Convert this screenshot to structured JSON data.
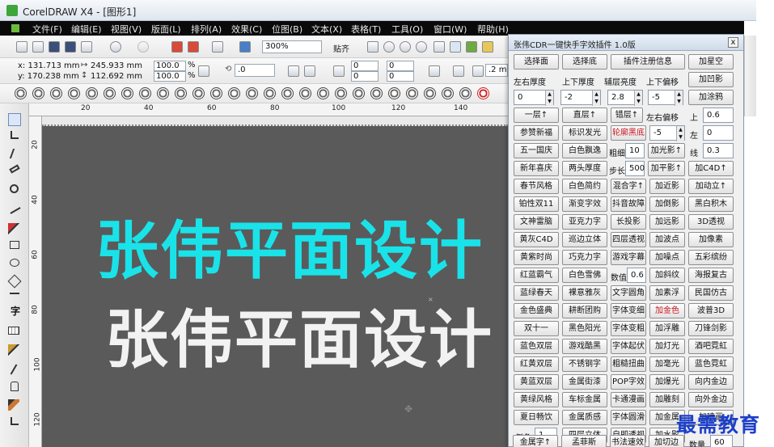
{
  "window": {
    "title": "CorelDRAW X4 - [图形1]"
  },
  "menu": [
    "文件(F)",
    "编辑(E)",
    "视图(V)",
    "版面(L)",
    "排列(A)",
    "效果(C)",
    "位图(B)",
    "文本(X)",
    "表格(T)",
    "工具(O)",
    "窗口(W)",
    "帮助(H)"
  ],
  "toolbar": {
    "zoom": "300%",
    "snap_label": "贴齐"
  },
  "property_bar": {
    "x": "x: 131.713 mm",
    "y": "y: 170.238 mm",
    "width": "245.933 mm",
    "height": "112.692 mm",
    "scale_x": "100.0",
    "scale_y": "100.0",
    "percent": "%",
    "angle": ".0",
    "nudge": ".2 mm",
    "offsets": [
      "0",
      "0",
      "0",
      "0"
    ]
  },
  "ruler": {
    "h_ticks": [
      "20",
      "40",
      "60",
      "80",
      "100",
      "120",
      "140"
    ],
    "v_ticks": [
      "20",
      "40",
      "60",
      "80",
      "100",
      "120"
    ]
  },
  "canvas": {
    "text_cyan": "张伟平面设计",
    "text_white": "张伟平面设计",
    "colors": {
      "cyan": "#19e3e9",
      "white": "#f2f2f2",
      "background": "#5a5a5a"
    }
  },
  "plugin": {
    "title": "张伟CDR一键快手字效插件  1.0版",
    "close": "x",
    "row1": [
      "选择面",
      "选择底",
      "插件注册信息",
      "加星空"
    ],
    "labels_row2": [
      "左右厚度",
      "上下厚度",
      "辅层亮度",
      "上下偏移"
    ],
    "add_shadow": "加凹影",
    "fields_row3": [
      "0",
      "-2",
      "2.8",
      "-5"
    ],
    "add_rust": "加涂鸦",
    "row4": [
      "一层↑",
      "直层↑",
      "错层↑"
    ],
    "lr_offset": "左右偏移",
    "up_label": "上",
    "up_value": "0.6",
    "row5": [
      "参赞新福",
      "标识发光",
      "轮廓黑底"
    ],
    "row5_field": "-5",
    "left_label": "左",
    "left_value": "0",
    "row6": [
      "五一国庆",
      "白色飘逸"
    ],
    "thick_label": "粗细",
    "thick_value": "10",
    "row6_btn": "加光影↑",
    "line_label": "线",
    "line_value": "0.3",
    "row7": [
      "新年喜庆",
      "两头厚度"
    ],
    "step_label": "步长",
    "step_value": "500",
    "row7_btns": [
      "加平影↑",
      "加C4D↑"
    ],
    "grid": [
      [
        "春节风格",
        "白色简约",
        "混合字↑",
        "加近影",
        "加动立↑"
      ],
      [
        "铂性双11",
        "渐变字效",
        "抖音故障",
        "加倒影",
        "黑白积木"
      ],
      [
        "文神雷脑",
        "亚克力字",
        "长投影",
        "加远影",
        "3D透视"
      ],
      [
        "黄灰C4D",
        "巡边立体",
        "四层透视",
        "加波点",
        "加像素"
      ],
      [
        "黄紫时尚",
        "巧克力字",
        "游戏字幕",
        "加噪点",
        "五彩缤纷"
      ]
    ],
    "row_num": {
      "a": "红蓝霸气",
      "b": "白色雪佛",
      "label": "数值",
      "value": "0.6",
      "c": "加斜纹",
      "d": "海报复古"
    },
    "grid2": [
      [
        "蓝绿春天",
        "裸意雅灰",
        "文字圆角",
        "加素浮",
        "民国仿古"
      ],
      [
        "金色盛典",
        "耕断团购",
        "字体变细",
        "加金色",
        "波普3D"
      ],
      [
        "双十一",
        "黑色阳光",
        "字体变粗",
        "加浮雕",
        "刀锋剑影"
      ],
      [
        "蓝色双层",
        "游戏酷黑",
        "字体起伏",
        "加灯光",
        "酒吧霓虹"
      ],
      [
        "红黄双层",
        "不锈钢字",
        "粗糙扭曲",
        "加毫光",
        "蓝色霓虹"
      ],
      [
        "黄蓝双层",
        "金属街漆",
        "POP字效",
        "加爆光",
        "向内金边"
      ],
      [
        "黄绿风格",
        "车标金属",
        "卡通漫画",
        "加雕刻",
        "向外金边"
      ],
      [
        "夏日畅饮",
        "金属质感",
        "字体圆滑",
        "加金属",
        "加喷画"
      ]
    ],
    "row_angle": {
      "label": "倒角",
      "value": "1",
      "a": "四层立体",
      "b": "自即透视",
      "c": "加水影"
    },
    "row_last": {
      "a": "金属字↑",
      "b": "孟菲斯",
      "c": "书法速效",
      "d": "加切边",
      "label": "数量",
      "value": "60"
    }
  },
  "watermark": "最需教育"
}
